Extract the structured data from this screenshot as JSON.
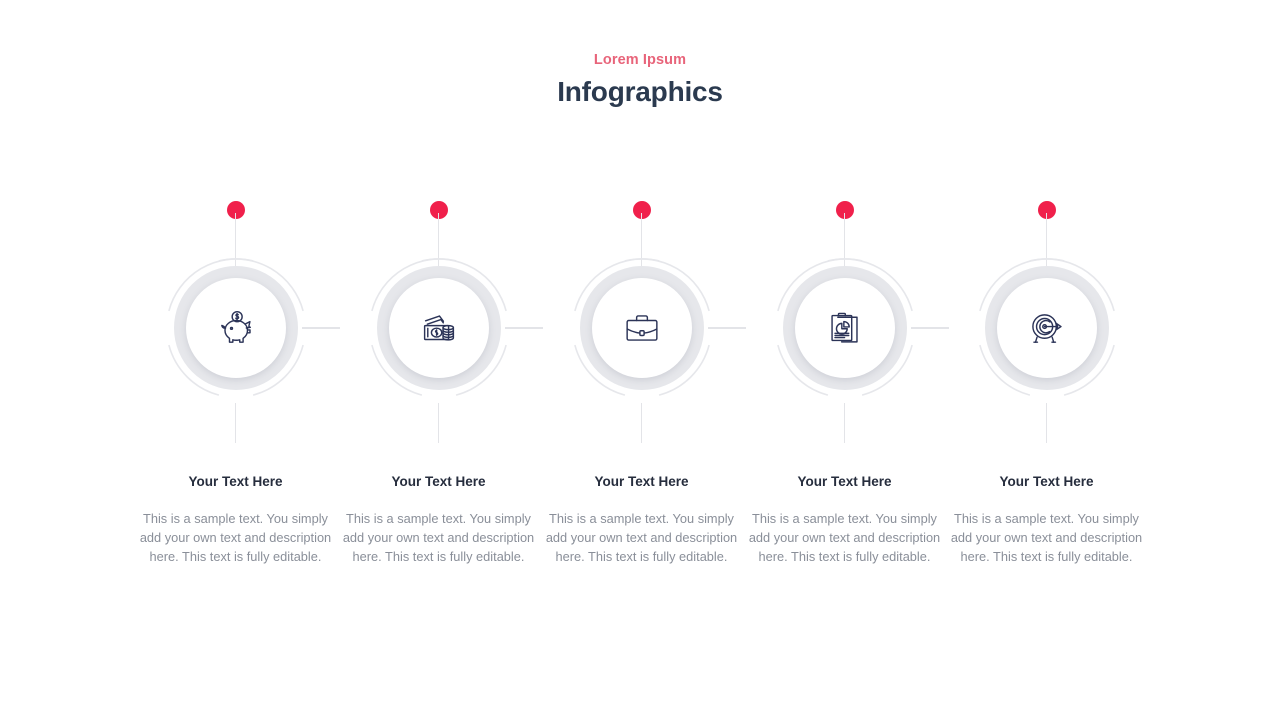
{
  "header": {
    "eyebrow": "Lorem Ipsum",
    "title": "Infographics"
  },
  "colors": {
    "pin_dot": "#f0204b",
    "eyebrow_text": "#e8647a",
    "title_text": "#2b3a4f",
    "icon_stroke": "#2b3357",
    "ring_gray": "#e6e7eb",
    "line_gray": "#e3e4e8",
    "caption_title_text": "#262d3d",
    "caption_body_text": "#8a8f99",
    "background": "#ffffff"
  },
  "steps": [
    {
      "icon": "piggy-bank-icon",
      "pin": "red-dot-marker",
      "title": "Your Text Here",
      "body": "This is a sample text. You simply add your own text and description here. This text is fully editable."
    },
    {
      "icon": "cash-coins-icon",
      "pin": "red-dot-marker",
      "title": "Your Text Here",
      "body": "This is a sample text. You simply add your own text and description here. This text is fully editable."
    },
    {
      "icon": "briefcase-icon",
      "pin": "red-dot-marker",
      "title": "Your Text Here",
      "body": "This is a sample text. You simply add your own text and description here. This text is fully editable."
    },
    {
      "icon": "report-pie-chart-icon",
      "pin": "red-dot-marker",
      "title": "Your Text Here",
      "body": "This is a sample text. You simply add your own text and description here. This text is fully editable."
    },
    {
      "icon": "target-arrow-icon",
      "pin": "red-dot-marker",
      "title": "Your Text Here",
      "body": "This is a sample text. You simply add your own text and description here. This text is fully editable."
    }
  ]
}
